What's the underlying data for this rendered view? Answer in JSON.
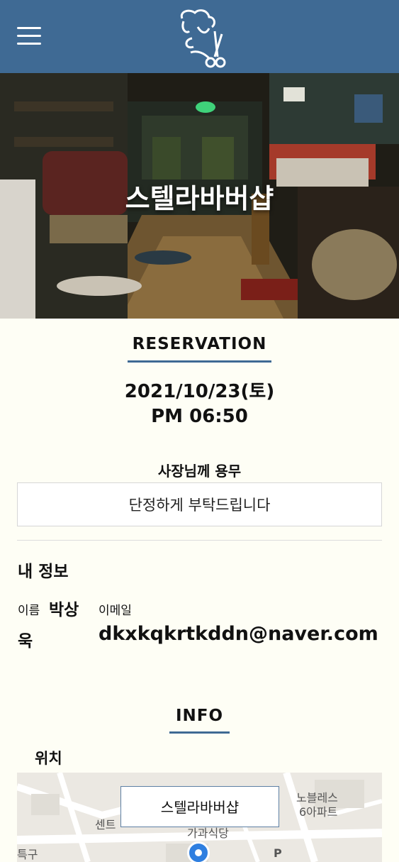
{
  "header": {
    "menu_icon": "hamburger-menu-icon",
    "logo_icon": "barber-logo-icon",
    "brand_color": "#3f6a94"
  },
  "hero": {
    "shop_name": "스텔라바버샵",
    "image": "barbershop-interior-photo"
  },
  "reservation": {
    "title": "RESERVATION",
    "date": "2021/10/23(토)",
    "time": "PM 06:50",
    "request_label": "사장님께 용무",
    "request_text": "단정하게 부탁드립니다"
  },
  "my_info": {
    "title": "내 정보",
    "name_label": "이름",
    "name_part1": "박상",
    "name_part2": "욱",
    "email_label": "이메일",
    "email": "dkxkqkrtkddn@naver.com"
  },
  "info": {
    "title": "INFO",
    "location_label": "위치",
    "map": {
      "popup_label": "스텔라바버샵",
      "labels": [
        "노블레스",
        "6아파트",
        "센트",
        "가과식당",
        "특구",
        "P"
      ],
      "marker_icon": "location-pin-icon"
    }
  }
}
